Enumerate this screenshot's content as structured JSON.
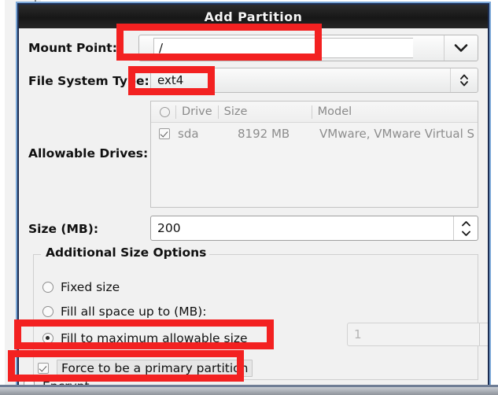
{
  "window": {
    "title": "Add Partition"
  },
  "form": {
    "mount_point": {
      "label": "Mount Point:",
      "value": "/",
      "dropdown_icon": "chevron-down-icon"
    },
    "file_system_type": {
      "label": "File System Type:",
      "value": "ext4",
      "spinner_icon": "up-down-chevrons-icon"
    },
    "allowable_drives": {
      "label": "Allowable Drives:",
      "columns": [
        "",
        "Drive",
        "Size",
        "Model"
      ],
      "rows": [
        {
          "selected": true,
          "drive": "sda",
          "size": "8192 MB",
          "model": "VMware, VMware Virtual S"
        }
      ]
    },
    "size_mb": {
      "label": "Size (MB):",
      "value": "200"
    },
    "additional_size_options": {
      "legend": "Additional Size Options",
      "options": [
        {
          "label": "Fixed size",
          "selected": false
        },
        {
          "label": "Fill all space up to (MB):",
          "selected": false
        },
        {
          "label": "Fill to maximum allowable size",
          "selected": true
        }
      ],
      "fill_up_to_value": "1"
    },
    "force_primary": {
      "label": "Force to be a primary partition",
      "checked": true
    },
    "encrypt": {
      "label": "Encrypt",
      "checked": false
    }
  },
  "annotations": {
    "color": "#f32121",
    "boxes": [
      "mount-point-field",
      "file-system-type-value",
      "fill-to-maximum-allowable-size",
      "force-to-be-a-primary-partition"
    ]
  }
}
